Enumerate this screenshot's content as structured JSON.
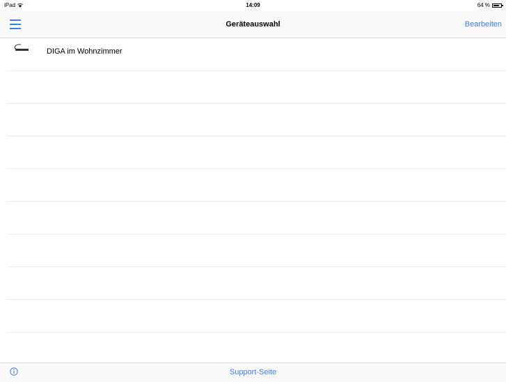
{
  "status_bar": {
    "carrier": "iPad",
    "time": "14:09",
    "battery_text": "64 %"
  },
  "nav": {
    "title": "Geräteauswahl",
    "edit_label": "Bearbeiten",
    "menu_icon": "hamburger-menu-icon"
  },
  "devices": [
    {
      "label": "DIGA im Wohnzimmer",
      "icon": "recorder-device-icon"
    }
  ],
  "toolbar": {
    "support_label": "Support-Seite",
    "info_icon": "info-icon"
  },
  "colors": {
    "accent": "#3a7ee8",
    "separator": "#ececef",
    "bar_background": "#f9f9f9"
  }
}
